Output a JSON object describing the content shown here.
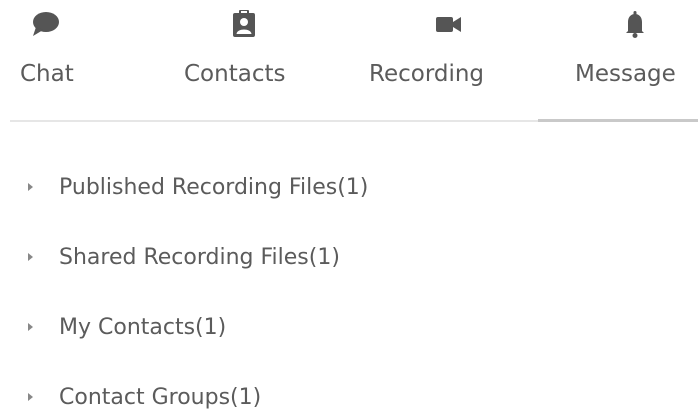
{
  "tabs": {
    "chat": {
      "label": "Chat",
      "icon": "chat-bubble-icon"
    },
    "contacts": {
      "label": "Contacts",
      "icon": "contact-card-icon"
    },
    "recording": {
      "label": "Recording",
      "icon": "video-camera-icon"
    },
    "message": {
      "label": "Message",
      "icon": "bell-icon",
      "active": true
    }
  },
  "tree": {
    "items": [
      {
        "label": "Published Recording Files(1)",
        "icon": "caret-right-icon"
      },
      {
        "label": "Shared Recording Files(1)",
        "icon": "caret-right-icon"
      },
      {
        "label": "My Contacts(1)",
        "icon": "caret-right-icon"
      },
      {
        "label": "Contact Groups(1)",
        "icon": "caret-right-icon"
      }
    ]
  },
  "colors": {
    "text": "#5b5b5b",
    "icon": "#555555",
    "divider": "#e6e6e6",
    "active_indicator": "#c9c9c9"
  }
}
